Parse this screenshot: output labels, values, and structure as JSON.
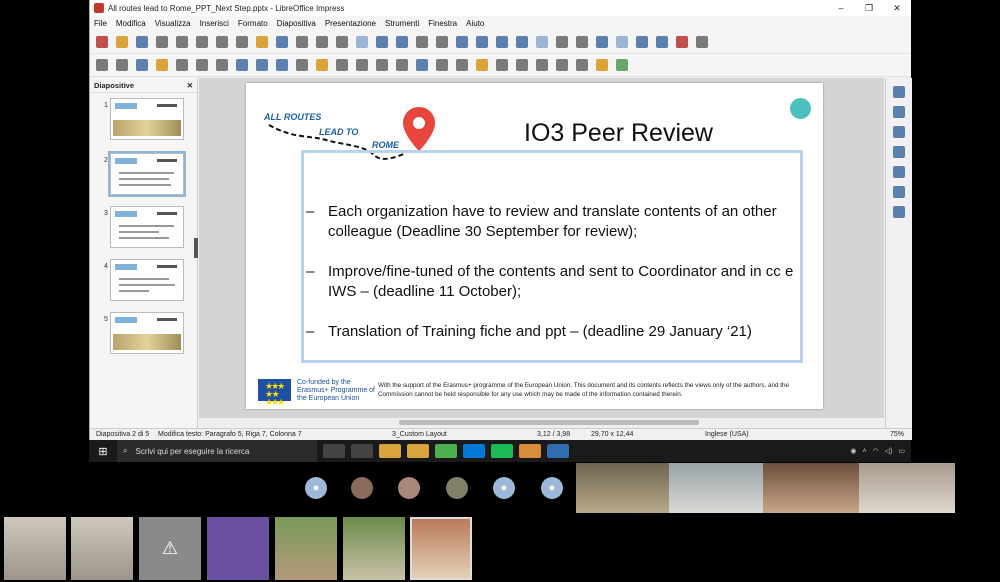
{
  "window": {
    "title": "All routes lead to Rome_PPT_Next Step.pptx - LibreOffice Impress",
    "minimize": "–",
    "restore": "❐",
    "close": "✕"
  },
  "menu": [
    "File",
    "Modifica",
    "Visualizza",
    "Inserisci",
    "Formato",
    "Diapositiva",
    "Presentazione",
    "Strumenti",
    "Finestra",
    "Aiuto"
  ],
  "slide_pane": {
    "header": "Diapositive",
    "close": "✕",
    "slides": [
      {
        "num": "1",
        "selected": false
      },
      {
        "num": "2",
        "selected": true
      },
      {
        "num": "3",
        "selected": false
      },
      {
        "num": "4",
        "selected": false
      },
      {
        "num": "5",
        "selected": false
      }
    ]
  },
  "slide": {
    "logo": {
      "line1": "ALL ROUTES",
      "line2": "LEAD TO",
      "line3": "ROME"
    },
    "title": "IO3 Peer Review",
    "bullets": [
      {
        "dash": "–",
        "text": "Each organization have to review and translate contents of an other colleague (Deadline 30 September for review);"
      },
      {
        "dash": "–",
        "text": "Improve/fine-tuned of the contents and sent to Coordinator and in cc e IWS – (deadline 11 October);"
      },
      {
        "dash": "–",
        "text": " Translation of Training fiche and ppt – (deadline 29 January ‘21)"
      }
    ],
    "eu_text": "Co-funded by the Erasmus+ Programme of the European Union",
    "disclaimer": "With the support of the Erasmus+ programme of the European Union. This document and its contents reflects the views only of the authors, and the Commission cannot be held responsible for any use which may be made of the information contained therein."
  },
  "status": {
    "slide": "Diapositiva 2 di 5",
    "edit": "Modifica testo: Paragrafo 5, Riga 7, Colonna 7",
    "layout": "3_Custom Layout",
    "position": "3,12 / 3,98",
    "size": "29,70 x 12,44",
    "language": "Inglese (USA)",
    "zoom": "75%"
  },
  "taskbar": {
    "search_placeholder": "Scrivi qui per eseguire la ricerca"
  }
}
